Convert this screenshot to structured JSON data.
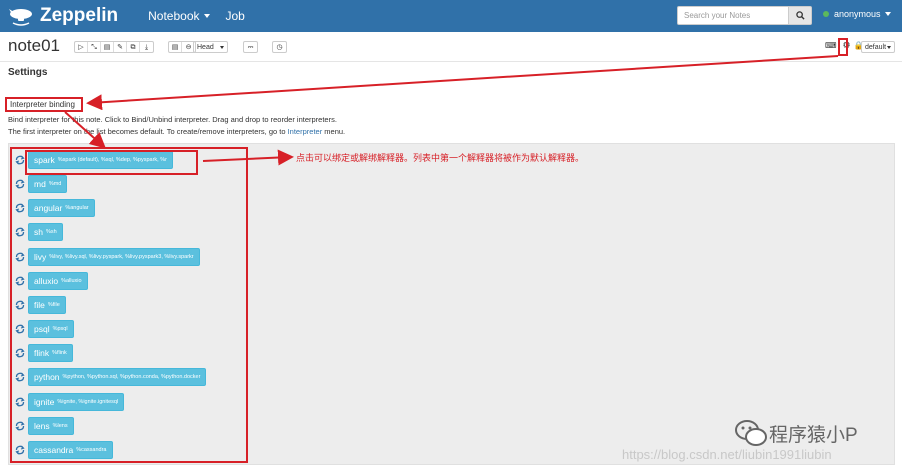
{
  "navbar": {
    "brand": "Zeppelin",
    "menu": [
      {
        "label": "Notebook"
      },
      {
        "label": "Job"
      }
    ],
    "search_placeholder": "Search your Notes",
    "user": "anonymous"
  },
  "note": {
    "title": "note01",
    "head_label": "Head",
    "default_label": "default"
  },
  "settings": {
    "title": "Settings",
    "binding_label": "Interpreter binding",
    "desc_line1": "Bind interpreter for this note. Click to Bind/Unbind interpreter. Drag and drop to reorder interpreters.",
    "desc_line2_prefix": "The first interpreter on the list becomes default. To create/remove interpreters, go to",
    "desc_link": "Interpreter",
    "desc_line2_suffix": "menu."
  },
  "interpreters": [
    {
      "name": "spark",
      "aliases": "%spark (default), %sql, %dep, %pyspark, %r"
    },
    {
      "name": "md",
      "aliases": "%md"
    },
    {
      "name": "angular",
      "aliases": "%angular"
    },
    {
      "name": "sh",
      "aliases": "%sh"
    },
    {
      "name": "livy",
      "aliases": "%livy, %livy.sql, %livy.pyspark, %livy.pyspark3, %livy.sparkr"
    },
    {
      "name": "alluxio",
      "aliases": "%alluxio"
    },
    {
      "name": "file",
      "aliases": "%file"
    },
    {
      "name": "psql",
      "aliases": "%psql"
    },
    {
      "name": "flink",
      "aliases": "%flink"
    },
    {
      "name": "python",
      "aliases": "%python, %python.sql, %python.conda, %python.docker"
    },
    {
      "name": "ignite",
      "aliases": "%ignite, %ignite.ignitesql"
    },
    {
      "name": "lens",
      "aliases": "%lens"
    },
    {
      "name": "cassandra",
      "aliases": "%cassandra"
    }
  ],
  "annotation": "点击可以绑定或解绑解释器。列表中第一个解释器将被作为默认解释器。",
  "watermark": {
    "brand": "程序猿小P",
    "url": "https://blog.csdn.net/liubin1991liubin"
  },
  "colors": {
    "navbar": "#3071a9",
    "interpreter_button": "#5bc0de",
    "highlight": "#d72027"
  }
}
